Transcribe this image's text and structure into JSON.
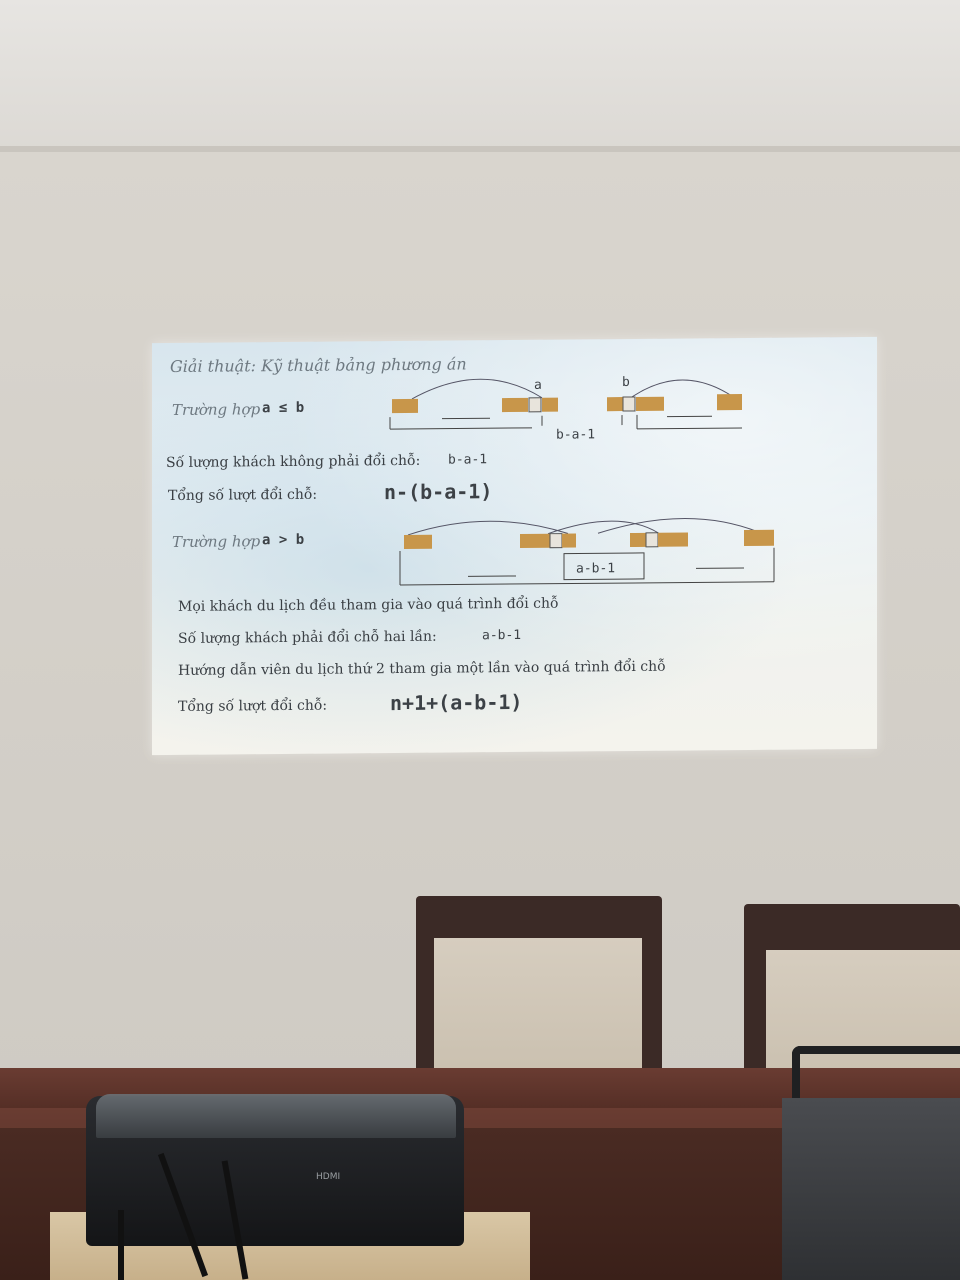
{
  "slide": {
    "title": "Giải thuật: Kỹ thuật bảng phương án",
    "case1_label": "Trường hợp",
    "case1_condition": "a ≤ b",
    "label_a": "a",
    "label_b": "b",
    "case1_gap": "b-a-1",
    "count_not_swap_label": "Số lượng khách không phải đổi chỗ:",
    "count_not_swap_value": "b-a-1",
    "total1_label": "Tổng số lượt đổi chỗ:",
    "total1_value": "n-(b-a-1)",
    "case2_label": "Trường hợp",
    "case2_condition": "a > b",
    "case2_gap": "a-b-1",
    "line1": "Mọi khách du lịch đều tham gia vào quá trình đổi chỗ",
    "line2_label": "Số lượng khách phải đổi chỗ hai lần:",
    "line2_value": "a-b-1",
    "line3": "Hướng dẫn viên du lịch thứ 2 tham gia một lần vào quá trình đổi chỗ",
    "line4_label": "Tổng số lượt đổi chỗ:",
    "line4_value": "n+1+(a-b-1)"
  },
  "projector": {
    "port_label": "HDMI"
  },
  "colors": {
    "block": "#c8964a",
    "slide_text": "#3a3f44",
    "table": "#4b2820"
  }
}
